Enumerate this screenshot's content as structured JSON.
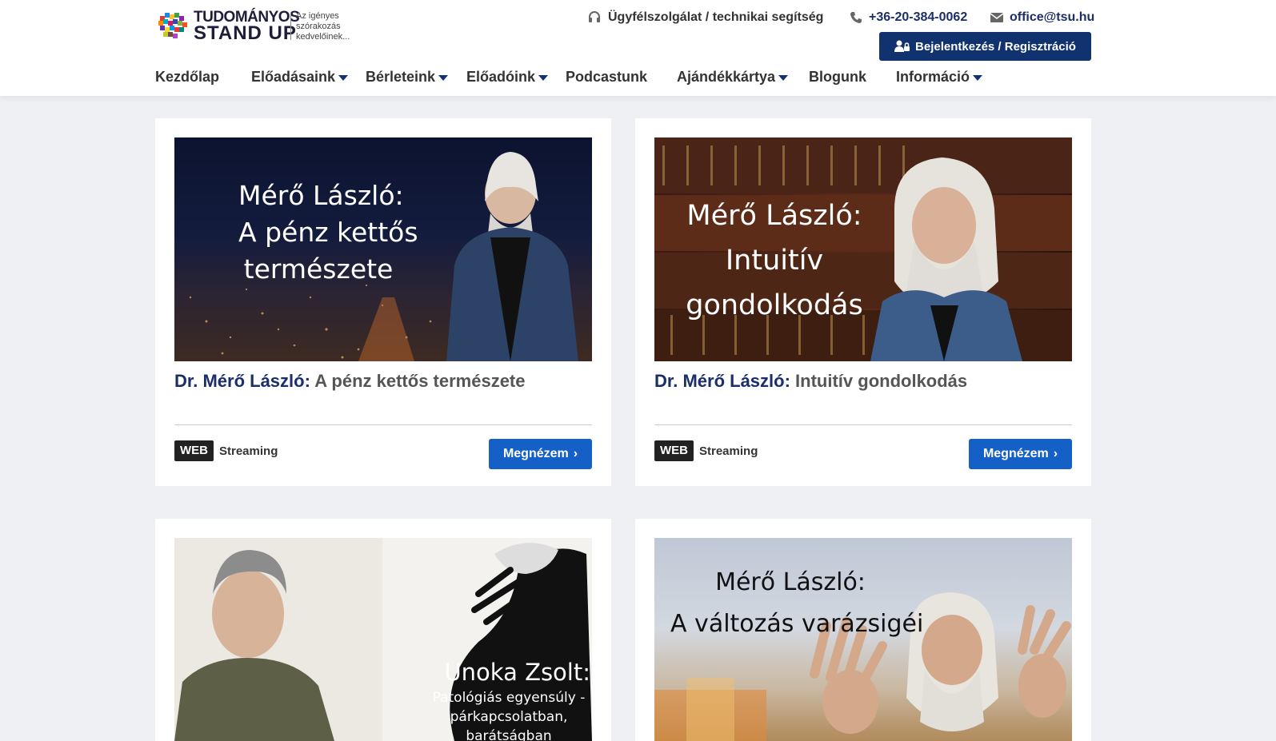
{
  "brand": {
    "name_line1": "TUDOMÁNYOS",
    "name_line2": "STAND UP",
    "tagline": "Az igényes szórakozás kedvelőinek..."
  },
  "topbar": {
    "support": "Ügyfélszolgálat / technikai segítség",
    "phone": "+36-20-384-0062",
    "email": "office@tsu.hu",
    "login_label": "Bejelentkezés / Regisztráció"
  },
  "nav": [
    {
      "label": "Kezdőlap",
      "dropdown": false
    },
    {
      "label": "Előadásaink",
      "dropdown": true
    },
    {
      "label": "Bérleteink",
      "dropdown": true
    },
    {
      "label": "Előadóink",
      "dropdown": true
    },
    {
      "label": "Podcastunk",
      "dropdown": false
    },
    {
      "label": "Ajándékkártya",
      "dropdown": true
    },
    {
      "label": "Blogunk",
      "dropdown": false
    },
    {
      "label": "Információ",
      "dropdown": true
    }
  ],
  "cards": [
    {
      "img_lines": [
        "Mérő László:",
        "A pénz kettős",
        "természete"
      ],
      "speaker": "Dr. Mérő László:",
      "title": "A pénz kettős természete",
      "badge": "WEB",
      "badge_text": "Streaming",
      "button": "Megnézem"
    },
    {
      "img_lines": [
        "Mérő László:",
        "Intuitív",
        "gondolkodás"
      ],
      "speaker": "Dr. Mérő László:",
      "title": "Intuitív gondolkodás",
      "badge": "WEB",
      "badge_text": "Streaming",
      "button": "Megnézem"
    },
    {
      "img_lines": [
        "Unoka Zsolt:",
        "Patológiás egyensúly -",
        "párkapcsolatban,",
        "barátságban"
      ]
    },
    {
      "img_lines": [
        "Mérő László:",
        "A változás varázsigéi"
      ]
    }
  ],
  "colors": {
    "navy": "#10326e",
    "link": "#1a2e6b",
    "button_blue": "#1560c6",
    "page_bg": "#eef0f3"
  }
}
